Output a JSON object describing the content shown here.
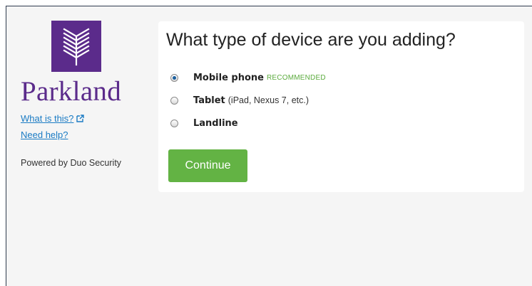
{
  "sidebar": {
    "brand_name": "Parkland",
    "what_is_this_link": "What is this?",
    "need_help_link": "Need help?",
    "powered_by": "Powered by Duo Security"
  },
  "main": {
    "title": "What type of device are you adding?",
    "options": [
      {
        "label": "Mobile phone",
        "extra": "",
        "badge": "RECOMMENDED",
        "selected": true
      },
      {
        "label": "Tablet",
        "extra": "(iPad, Nexus 7, etc.)",
        "badge": "",
        "selected": false
      },
      {
        "label": "Landline",
        "extra": "",
        "badge": "",
        "selected": false
      }
    ],
    "continue_label": "Continue"
  },
  "colors": {
    "brand_purple": "#5b2b8b",
    "link_blue": "#1a7bc4",
    "button_green": "#63b344",
    "recommended_green": "#5bab3d"
  },
  "icons": {
    "logo": "parkland-logo-icon",
    "external_link": "external-link-icon"
  }
}
